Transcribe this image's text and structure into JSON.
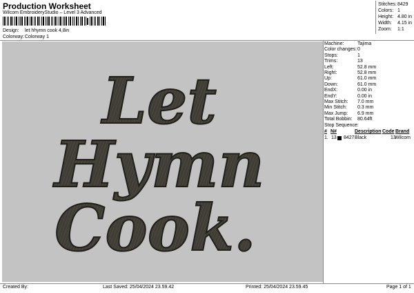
{
  "header": {
    "title": "Production Worksheet",
    "subtitle": "Wilcom EmbroideryStudio – Level 3 Advanced",
    "design_label": "Design:",
    "design_value": "let hhymn cook 4,8in",
    "colorway_label": "Colorway:",
    "colorway_value": "Colorway 1"
  },
  "stats": {
    "stitches_label": "Stitches:",
    "stitches_value": "8429",
    "colors_label": "Colors:",
    "colors_value": "1",
    "height_label": "Height:",
    "height_value": "4.80 in",
    "width_label": "Width:",
    "width_value": "4.15 in",
    "zoom_label": "Zoom:",
    "zoom_value": "1:1"
  },
  "design_text": {
    "line1": "Let",
    "line2": "Hymn",
    "line3": "Cook."
  },
  "machine": [
    {
      "label": "Machine:",
      "value": "Tajima"
    },
    {
      "label": "Color changes:",
      "value": "0"
    },
    {
      "label": "Stops:",
      "value": "1"
    },
    {
      "label": "Trims:",
      "value": "13"
    },
    {
      "label": "Left:",
      "value": "52.8 mm"
    },
    {
      "label": "Right:",
      "value": "52.8 mm"
    },
    {
      "label": "Up:",
      "value": "61.0 mm"
    },
    {
      "label": "Down:",
      "value": "61.0 mm"
    },
    {
      "label": "EndX:",
      "value": "0.00 in"
    },
    {
      "label": "EndY:",
      "value": "0.00 in"
    },
    {
      "label": "Max Stitch:",
      "value": "7.0 mm"
    },
    {
      "label": "Min Stitch:",
      "value": "0.3 mm"
    },
    {
      "label": "Max Jump:",
      "value": "6.9 mm"
    },
    {
      "label": "Total Bobbin:",
      "value": "80.64ft"
    }
  ],
  "stop_sequence": {
    "title": "Stop Sequence:",
    "headers": [
      "#",
      "N#",
      "Description",
      "Code",
      "Brand"
    ],
    "rows": [
      {
        "num": "1.",
        "n": "13",
        "stitches": "8427",
        "description": "Black",
        "code": "13",
        "brand": "Wilcom",
        "color": "#000000"
      }
    ]
  },
  "footer": {
    "created_by": "Created By:",
    "last_saved": "Last Saved: 25/04/2024 23.59.42",
    "printed": "Printed: 25/04/2024 23.59.45",
    "page": "Page 1 of 1"
  },
  "colors": {
    "preview_bg": "#c3c3c3",
    "thread": "#3f3d36"
  }
}
